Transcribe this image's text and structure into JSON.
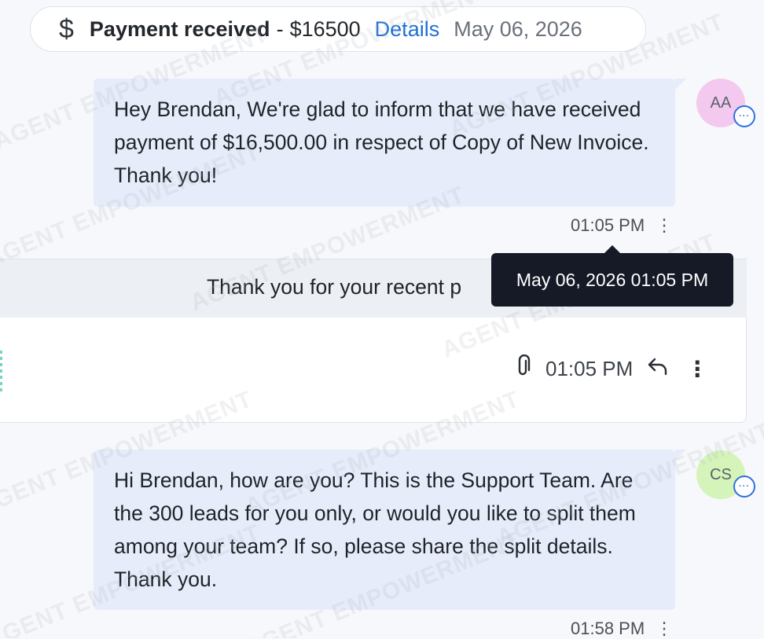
{
  "payment": {
    "icon": "dollar-icon",
    "title": "Payment received",
    "separator": "-",
    "amount": "$16500",
    "details_link": "Details",
    "date": "May 06, 2026"
  },
  "messages": [
    {
      "avatar": "AA",
      "avatar_color": "#f3c9f0",
      "text": "Hey Brendan, We're glad to inform that we have received payment of $16,500.00 in respect of Copy of New Invoice. Thank you!",
      "time": "01:05 PM",
      "menu_icon": "more-vertical-icon"
    },
    {
      "avatar": "CS",
      "avatar_color": "#d4f4b9",
      "text": "Hi Brendan, how are you? This is the Support Team. Are the 300 leads for you only, or would you like to split them among your team? If so, please share the split details. Thank you.",
      "time": "01:58 PM",
      "menu_icon": "more-vertical-icon"
    }
  ],
  "email": {
    "subject": "Thank you for your recent p",
    "time": "01:05 PM",
    "attachment_icon": "paperclip-icon",
    "reply_icon": "reply-icon",
    "menu_icon": "more-vertical-icon"
  },
  "tooltip": {
    "text": "May 06, 2026 01:05 PM"
  },
  "watermark": "AGENT EMPOWERMENT",
  "colors": {
    "accent": "#1f6fd6",
    "bubble": "#e7ecfa",
    "tooltip_bg": "#151a26",
    "page_bg": "#f7f8fb"
  }
}
